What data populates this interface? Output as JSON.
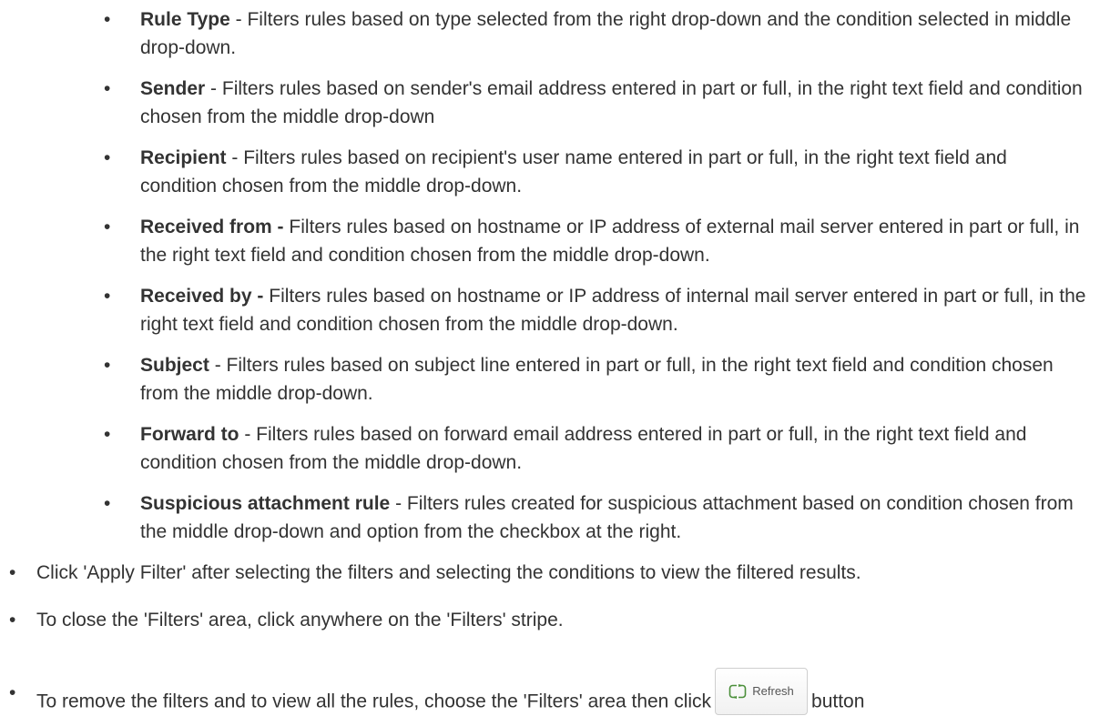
{
  "bullet_char": "•",
  "sub_items": [
    {
      "term": "Rule Type",
      "sep": " - ",
      "desc": "Filters rules based on type selected from the right drop-down and the condition selected in middle drop-down."
    },
    {
      "term": "Sender",
      "sep": " - ",
      "desc": "Filters rules based on sender's email address entered in part or full, in the right text field and condition chosen from the middle drop-down"
    },
    {
      "term": "Recipient",
      "sep": " - ",
      "desc": "Filters rules based on recipient's user name entered in part or full, in the right text field and condition chosen from the middle drop-down."
    },
    {
      "term": "Received from -",
      "sep": " ",
      "desc": "Filters rules based on hostname or IP address of external mail server entered in part or full, in the right text field and condition chosen from the middle drop-down."
    },
    {
      "term": "Received by -",
      "sep": " ",
      "desc": "Filters rules based on hostname or IP address of internal mail server entered in part or full, in the right text field and condition chosen from the middle drop-down."
    },
    {
      "term": "Subject",
      "sep": " - ",
      "desc": "Filters rules based on subject line entered in part or full, in the right text field and condition chosen from the middle drop-down."
    },
    {
      "term": "Forward to",
      "sep": " - ",
      "desc": "Filters rules based on forward email address entered in part or full, in the right text field and condition chosen from the middle drop-down."
    },
    {
      "term": "Suspicious attachment rule",
      "sep": " - ",
      "desc": "Filters rules created for suspicious attachment based on condition chosen from the middle drop-down and option from the checkbox at the right."
    }
  ],
  "top_items": [
    {
      "text": "Click 'Apply Filter' after selecting the filters and selecting the conditions to view the filtered results."
    },
    {
      "text": "To close the 'Filters' area, click anywhere on the 'Filters' stripe."
    },
    {
      "text_before": "To remove the filters and to view all the rules, choose the 'Filters' area then click",
      "text_after": "button"
    }
  ],
  "refresh_button": {
    "label": "Refresh",
    "icon": "refresh-icon"
  }
}
